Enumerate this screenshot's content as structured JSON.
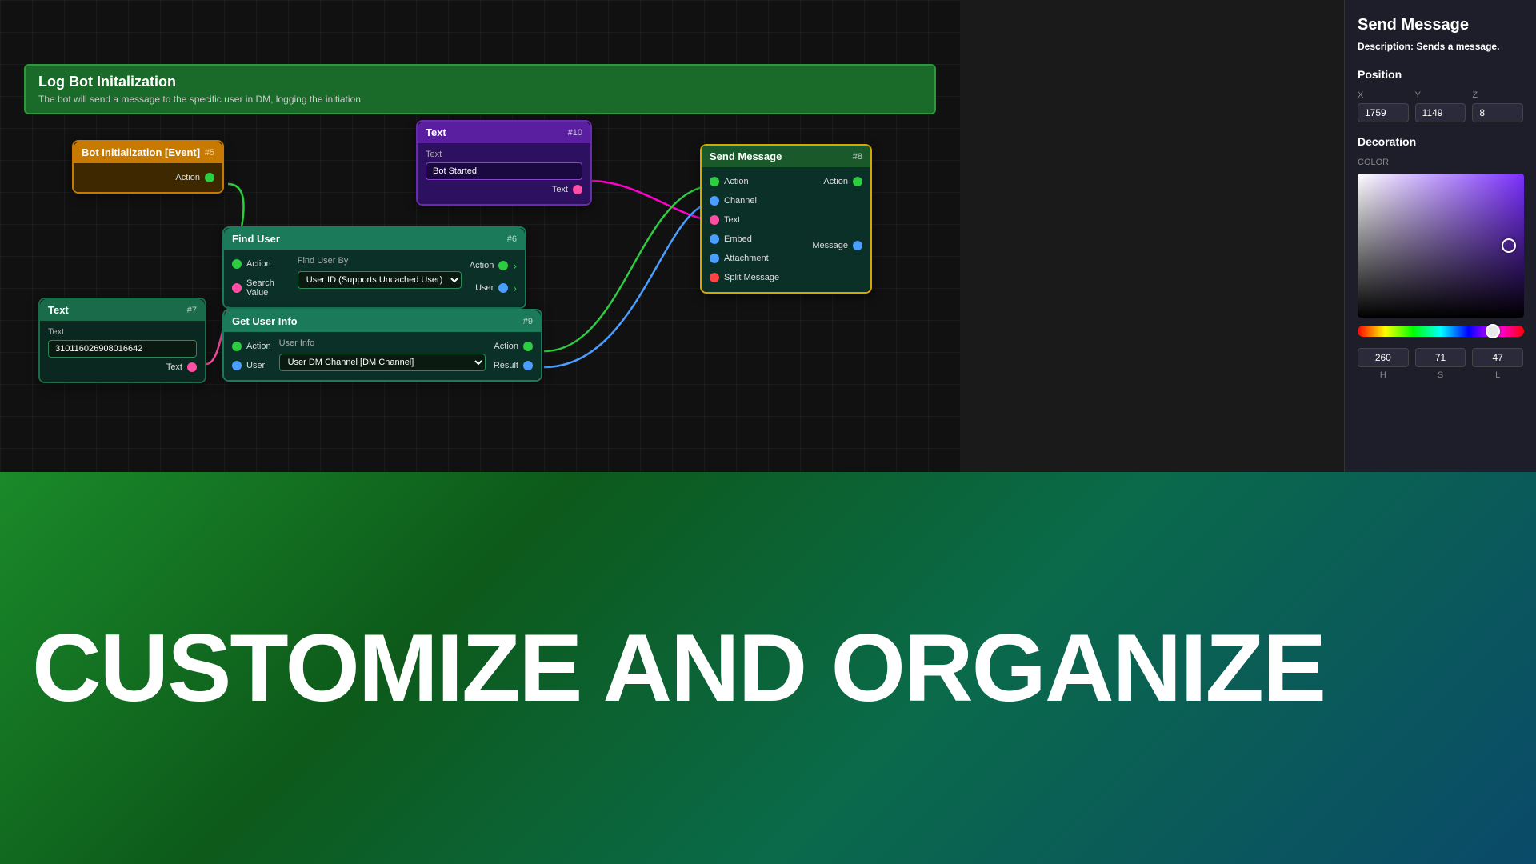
{
  "header": {
    "title": "Log Bot Initalization",
    "subtitle": "The bot will send a message to the specific user in DM, logging the initiation."
  },
  "nodes": {
    "bot_init": {
      "title": "Bot Initialization [Event]",
      "id": "#5",
      "output": "Action"
    },
    "text10": {
      "title": "Text",
      "id": "#10",
      "field_label": "Text",
      "field_value": "Bot Started!",
      "output": "Text"
    },
    "text7": {
      "title": "Text",
      "id": "#7",
      "field_label": "Text",
      "field_value": "310116026908016642",
      "output": "Text"
    },
    "find_user": {
      "title": "Find User",
      "id": "#6",
      "input1": "Action",
      "input2": "Search Value",
      "mid_label": "Find User By",
      "mid_value": "User ID (Supports Uncached User)",
      "output1": "Action",
      "output2": "User"
    },
    "get_user_info": {
      "title": "Get User Info",
      "id": "#9",
      "input1": "Action",
      "input2": "User",
      "mid_label": "User Info",
      "mid_value": "User DM Channel [DM Channel]",
      "output1": "Action",
      "output2": "Result"
    },
    "send_message": {
      "title": "Send Message",
      "id": "#8",
      "inputs": [
        "Action",
        "Channel",
        "Text",
        "Embed",
        "Attachment",
        "Split Message"
      ],
      "outputs": [
        "Action",
        "Message"
      ]
    }
  },
  "right_panel": {
    "title": "Send Message",
    "description": "Sends a message.",
    "position": {
      "x": "1759",
      "y": "1149",
      "z": "8"
    },
    "decoration": {
      "color_label": "COLOR",
      "h": "260",
      "s": "71",
      "l": "47"
    }
  },
  "bottom": {
    "text": "CUSTOMIZE AND ORGANIZE"
  },
  "colors": {
    "green": "#2ecc40",
    "blue": "#4a9eff",
    "pink": "#ff4da6",
    "red": "#ff4444",
    "orange": "#ff9900",
    "purple_border": "#d4a800"
  }
}
